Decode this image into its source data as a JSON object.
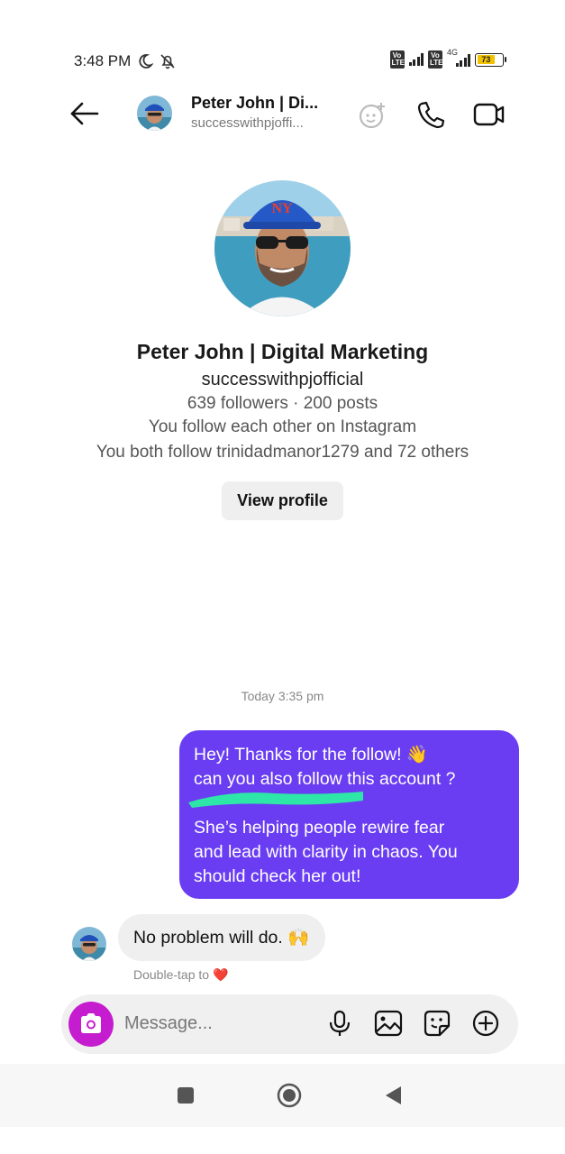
{
  "status_bar": {
    "time": "3:48 PM",
    "network_label": "4G",
    "battery": "73"
  },
  "header": {
    "name": "Peter John | Di...",
    "handle": "successwithpjoffi..."
  },
  "profile": {
    "name": "Peter John | Digital Marketing",
    "handle": "successwithpjofficial",
    "stats": "639 followers · 200 posts",
    "mutual": "You follow each other on Instagram",
    "follows": "You both follow trinidadmanor1279 and 72 others",
    "view_profile_label": "View profile"
  },
  "conversation": {
    "timestamp": "Today 3:35 pm",
    "sent_message": {
      "lines": [
        "Hey! Thanks for the follow! 👋",
        "can you also follow this account ?",
        "",
        "She’s helping people rewire fear",
        "and lead with clarity in chaos. You",
        "should check her out!"
      ]
    },
    "received_message": "No problem will do. 🙌",
    "double_tap_hint": "Double-tap to ❤️"
  },
  "composer": {
    "placeholder": "Message..."
  },
  "colors": {
    "sent_bubble": "#6a3df2",
    "camera_button": "#c61ccf",
    "redaction_scribble": "#2de6a7"
  },
  "icons": [
    "back-arrow-icon",
    "effects-icon",
    "phone-icon",
    "video-icon",
    "camera-icon",
    "microphone-icon",
    "gallery-icon",
    "sticker-icon",
    "plus-icon",
    "recents-icon",
    "home-icon",
    "back-nav-icon"
  ]
}
